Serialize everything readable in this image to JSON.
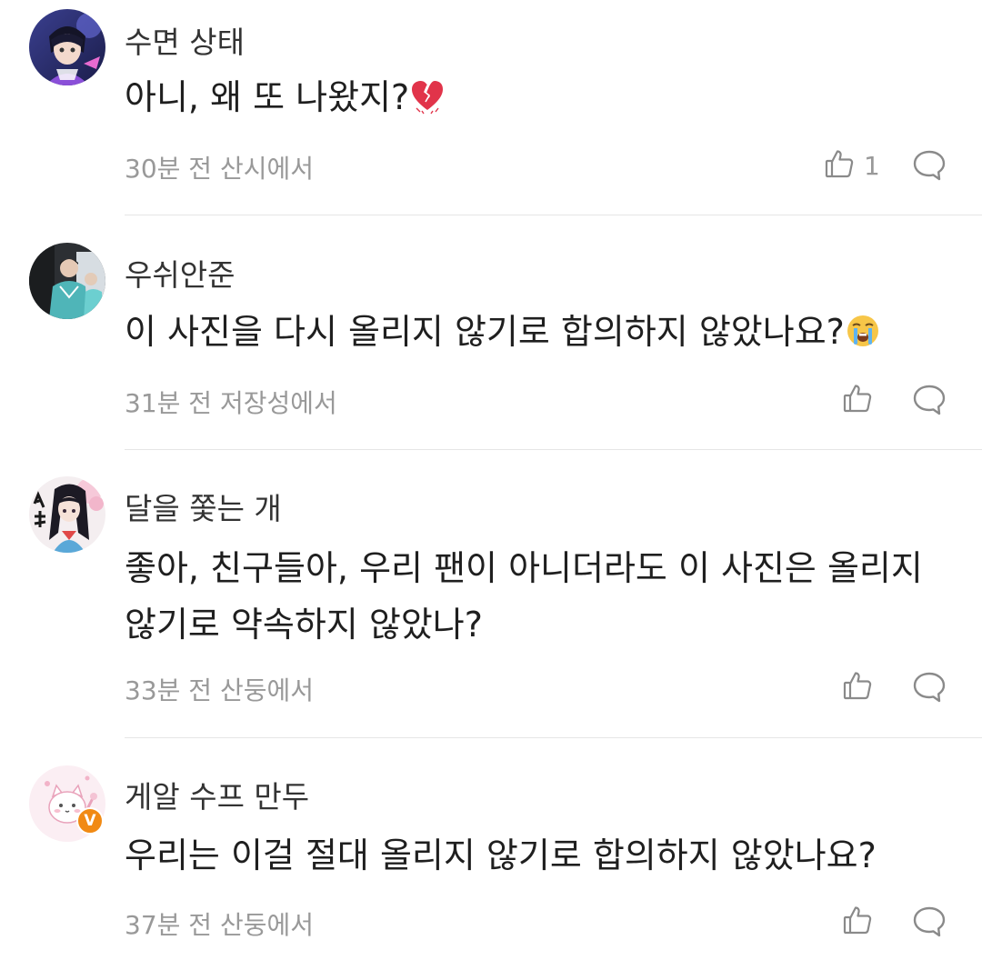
{
  "comments": [
    {
      "username": "수면 상태",
      "text": "아니, 왜 또 나왔지?",
      "emoji": "broken-heart",
      "meta": "30분 전 산시에서",
      "likes": "1"
    },
    {
      "username": "우쉬안준",
      "text": "이 사진을 다시 올리지 않기로 합의하지 않았나요?",
      "emoji": "loudly-crying-face",
      "meta": "31분 전 저장성에서",
      "likes": ""
    },
    {
      "username": "달을 쫓는 개",
      "text": "좋아, 친구들아, 우리 팬이 아니더라도 이 사진은 올리지 않기로 약속하지 않았나?",
      "meta": "33분 전 산둥에서",
      "likes": ""
    },
    {
      "username": "게알 수프 만두",
      "text": "우리는 이걸 절대 올리지 않기로 합의하지 않았나요?",
      "meta": "37분 전 산둥에서",
      "likes": "",
      "verified_badge": "V"
    }
  ],
  "icons": {
    "like": "thumbs-up-icon",
    "reply": "speech-bubble-icon"
  },
  "colors": {
    "meta_text": "#999999",
    "divider": "#e6e6e6",
    "verified_badge": "#f18a14"
  }
}
